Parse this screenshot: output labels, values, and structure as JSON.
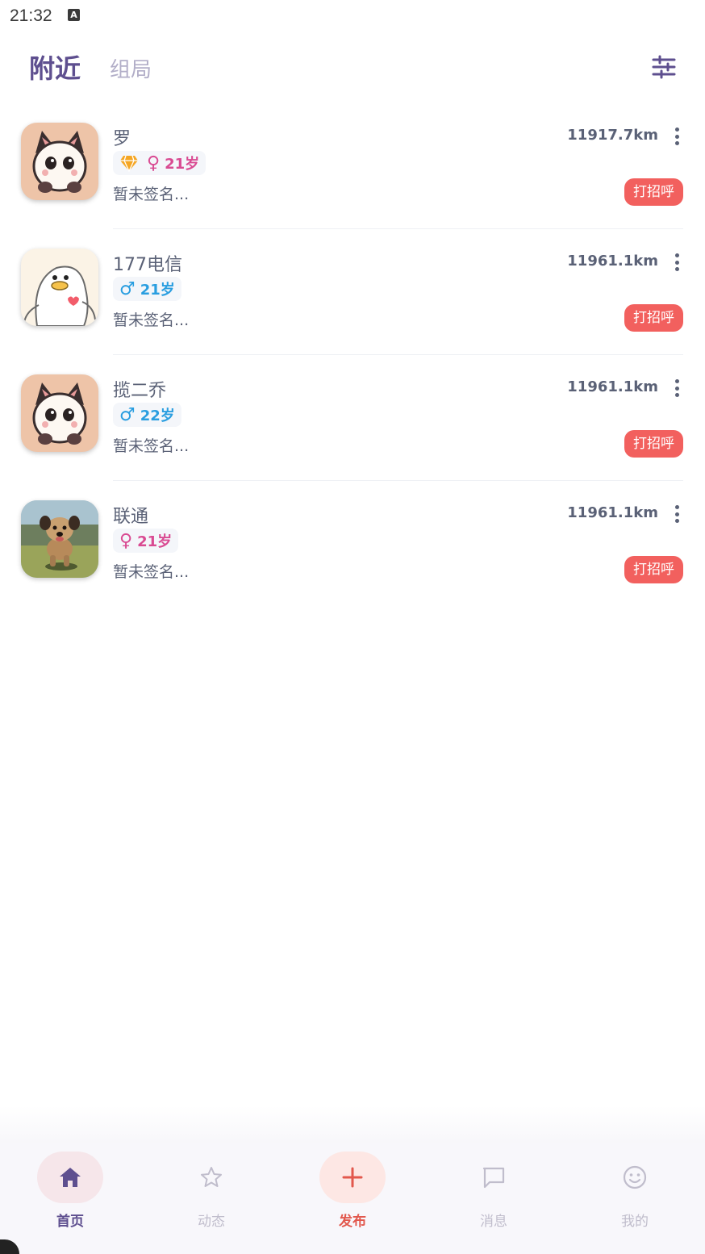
{
  "status_bar": {
    "time": "21:32",
    "indicator": "A"
  },
  "header": {
    "tabs": [
      {
        "label": "附近",
        "active": true
      },
      {
        "label": "组局",
        "active": false
      }
    ],
    "filter_icon": "sliders-icon"
  },
  "users": [
    {
      "name": "罗",
      "gender": "female",
      "gender_symbol": "♀",
      "age": "21岁",
      "vip": true,
      "signature": "暂未签名...",
      "distance": "11917.7km",
      "greet_label": "打招呼",
      "avatar": "cat-avatar"
    },
    {
      "name": "177电信",
      "gender": "male",
      "gender_symbol": "♂",
      "age": "21岁",
      "vip": false,
      "signature": "暂未签名...",
      "distance": "11961.1km",
      "greet_label": "打招呼",
      "avatar": "duck-avatar"
    },
    {
      "name": "揽二乔",
      "gender": "male",
      "gender_symbol": "♂",
      "age": "22岁",
      "vip": false,
      "signature": "暂未签名...",
      "distance": "11961.1km",
      "greet_label": "打招呼",
      "avatar": "cat-avatar"
    },
    {
      "name": "联通",
      "gender": "female",
      "gender_symbol": "♀",
      "age": "21岁",
      "vip": false,
      "signature": "暂未签名...",
      "distance": "11961.1km",
      "greet_label": "打招呼",
      "avatar": "dog-photo-avatar"
    }
  ],
  "bottom_nav": [
    {
      "label": "首页",
      "icon": "home-icon",
      "active": true
    },
    {
      "label": "动态",
      "icon": "star-icon",
      "active": false
    },
    {
      "label": "发布",
      "icon": "plus-icon",
      "active": false
    },
    {
      "label": "消息",
      "icon": "chat-icon",
      "active": false
    },
    {
      "label": "我的",
      "icon": "smile-icon",
      "active": false
    }
  ],
  "colors": {
    "accent": "#5e4f8f",
    "greet": "#f2605e",
    "female": "#d94a92",
    "male": "#2a9ee0"
  }
}
